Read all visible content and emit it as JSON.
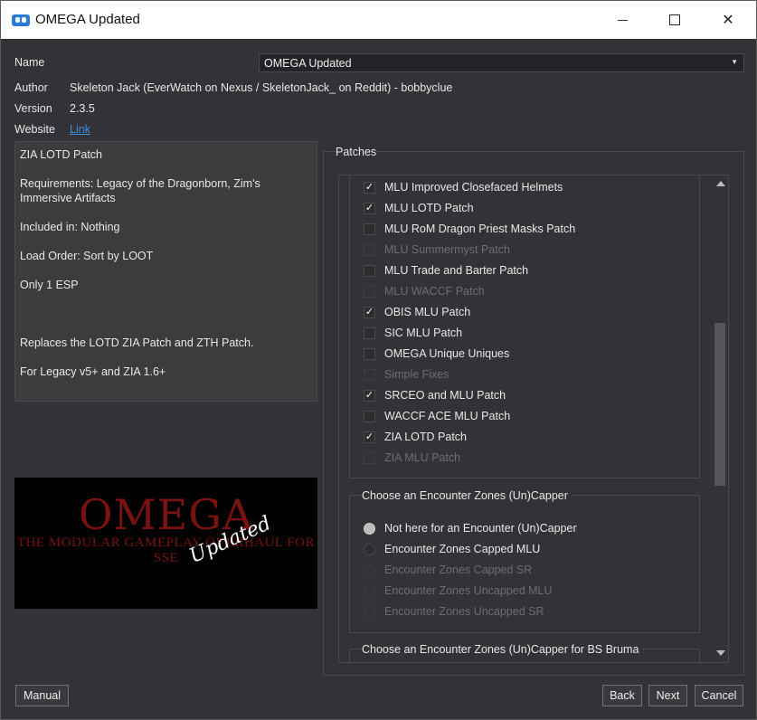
{
  "window": {
    "title": "OMEGA Updated",
    "close_glyph": "✕"
  },
  "info": {
    "name_label": "Name",
    "name_value": "OMEGA Updated",
    "author_label": "Author",
    "author_value": "Skeleton Jack (EverWatch on Nexus / SkeletonJack_ on Reddit) - bobbyclue",
    "version_label": "Version",
    "version_value": "2.3.5",
    "website_label": "Website",
    "website_link": "Link"
  },
  "description": {
    "lines": [
      "ZIA LOTD Patch",
      "Requirements: Legacy of the Dragonborn, Zim's Immersive Artifacts",
      "Included in: Nothing",
      "Load Order: Sort by LOOT",
      "Only 1 ESP",
      "",
      "Replaces the LOTD ZIA Patch and ZTH Patch.",
      "For Legacy v5+ and ZIA 1.6+"
    ]
  },
  "banner": {
    "title": "OMEGA",
    "subtitle": "THE MODULAR GAMEPLAY OVERHAUL FOR SSE",
    "overlay": "Updated"
  },
  "patches": {
    "title": "Patches",
    "items": [
      {
        "label": "MLU Improved Closefaced Helmets",
        "checked": true,
        "enabled": true,
        "mark": "✓"
      },
      {
        "label": "MLU LOTD Patch",
        "checked": true,
        "enabled": true,
        "mark": "✓"
      },
      {
        "label": "MLU RoM Dragon Priest Masks Patch",
        "checked": false,
        "enabled": true,
        "mark": ""
      },
      {
        "label": "MLU Summermyst Patch",
        "checked": false,
        "enabled": false,
        "mark": ""
      },
      {
        "label": "MLU Trade and Barter Patch",
        "checked": false,
        "enabled": true,
        "mark": ""
      },
      {
        "label": "MLU WACCF Patch",
        "checked": false,
        "enabled": false,
        "mark": ""
      },
      {
        "label": "OBIS MLU Patch",
        "checked": true,
        "enabled": true,
        "mark": "✓"
      },
      {
        "label": "SIC MLU Patch",
        "checked": false,
        "enabled": true,
        "mark": ""
      },
      {
        "label": "OMEGA Unique Uniques",
        "checked": false,
        "enabled": true,
        "mark": ""
      },
      {
        "label": "Simple Fixes",
        "checked": false,
        "enabled": false,
        "mark": ""
      },
      {
        "label": "SRCEO and MLU Patch",
        "checked": true,
        "enabled": true,
        "mark": "✓"
      },
      {
        "label": "WACCF ACE MLU Patch",
        "checked": false,
        "enabled": true,
        "mark": ""
      },
      {
        "label": "ZIA LOTD Patch",
        "checked": true,
        "enabled": true,
        "mark": "✓"
      },
      {
        "label": "ZIA MLU Patch",
        "checked": false,
        "enabled": false,
        "mark": ""
      }
    ],
    "encounter_group": {
      "title": "Choose an Encounter Zones (Un)Capper",
      "options": [
        {
          "label": "Not here for an Encounter (Un)Capper",
          "selected": true,
          "enabled": true
        },
        {
          "label": "Encounter Zones Capped MLU",
          "selected": false,
          "enabled": true
        },
        {
          "label": "Encounter Zones Capped SR",
          "selected": false,
          "enabled": false
        },
        {
          "label": "Encounter Zones Uncapped MLU",
          "selected": false,
          "enabled": false
        },
        {
          "label": "Encounter Zones Uncapped SR",
          "selected": false,
          "enabled": false
        }
      ]
    },
    "bruma_group": {
      "title": "Choose an Encounter Zones (Un)Capper for BS Bruma"
    }
  },
  "buttons": {
    "manual": "Manual",
    "back": "Back",
    "next": "Next",
    "cancel": "Cancel"
  }
}
